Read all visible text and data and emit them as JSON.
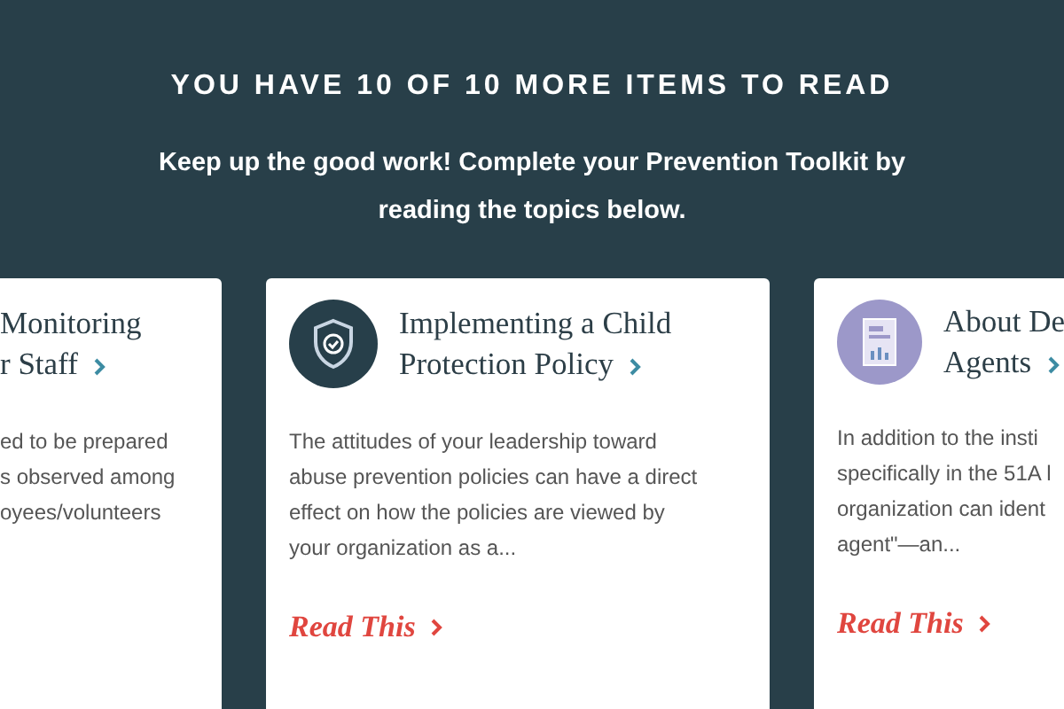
{
  "header": {
    "title": "YOU HAVE 10 OF 10 MORE ITEMS TO READ",
    "subtitle": "Keep up the good work! Complete your Prevention Toolkit by reading the topics below."
  },
  "cards": [
    {
      "kind": "none",
      "title_lines": [
        "Monitoring",
        "r Staff"
      ],
      "body_lines": [
        "ed to be prepared",
        "s observed among",
        "oyees/volunteers"
      ]
    },
    {
      "kind": "shield",
      "color": "#273f4a",
      "title_lines": [
        "Implementing a Child",
        "Protection Policy"
      ],
      "body_lines": [
        "The attitudes of your leadership toward",
        "abuse prevention policies can have a direct",
        "effect on how the policies are viewed by",
        "your organization as a..."
      ],
      "link": "Read This"
    },
    {
      "kind": "document",
      "color": "#9c98c9",
      "title_lines": [
        "About De",
        "Agents"
      ],
      "body_lines": [
        "In addition to the insti",
        "specifically in the 51A l",
        "organization can ident",
        "agent\"—an..."
      ],
      "link": "Read This"
    }
  ]
}
